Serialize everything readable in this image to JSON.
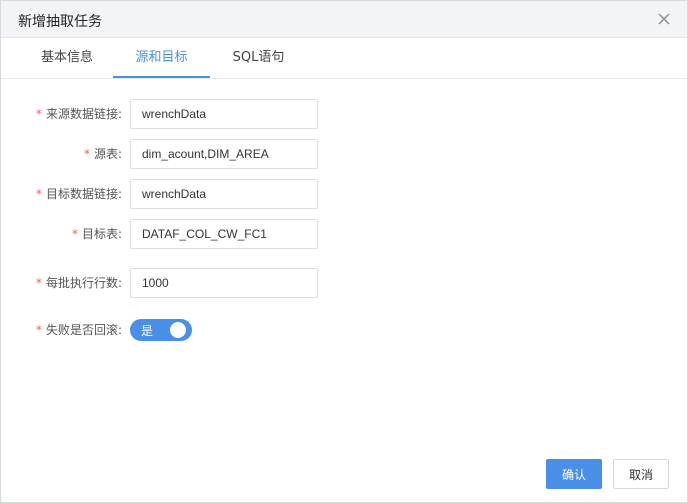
{
  "dialog": {
    "title": "新增抽取任务",
    "close_icon": "close-icon"
  },
  "tabs": [
    {
      "label": "基本信息",
      "active": false
    },
    {
      "label": "源和目标",
      "active": true
    },
    {
      "label": "SQL语句",
      "active": false
    }
  ],
  "form": {
    "required_mark": "*",
    "source_conn": {
      "label": "来源数据链接:",
      "value": "wrenchData"
    },
    "source_table": {
      "label": "源表:",
      "value": "dim_acount,DIM_AREA"
    },
    "target_conn": {
      "label": "目标数据链接:",
      "value": "wrenchData"
    },
    "target_table": {
      "label": "目标表:",
      "value": "DATAF_COL_CW_FC1"
    },
    "batch_rows": {
      "label": "每批执行行数:",
      "value": "1000"
    },
    "rollback": {
      "label": "失败是否回滚:",
      "switch_text": "是",
      "on": true
    }
  },
  "buttons": {
    "confirm": "确认",
    "cancel": "取消"
  },
  "colors": {
    "accent": "#4a8fe7",
    "required": "#f25c5c"
  }
}
